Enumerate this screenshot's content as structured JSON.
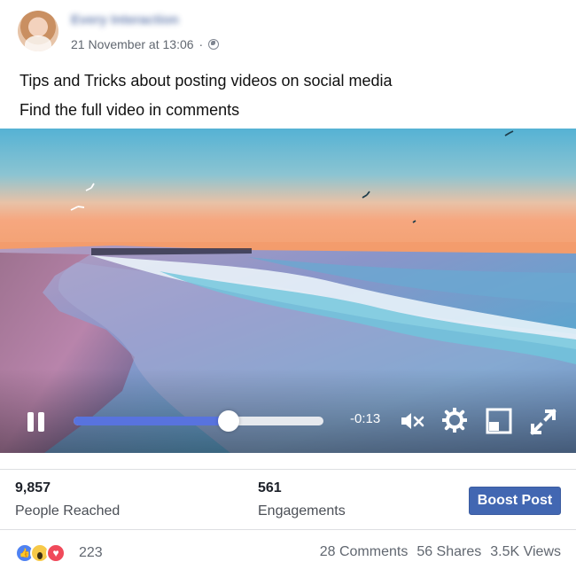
{
  "post": {
    "author": "Every Interaction",
    "timestamp": "21 November at 13:06",
    "separator": "·",
    "text_line_1": "Tips and Tricks about posting videos on social media",
    "text_line_2": "Find the full video in comments"
  },
  "video": {
    "time_remaining": "-0:13",
    "progress_fraction": 0.62
  },
  "insights": {
    "people_reached_value": "9,857",
    "people_reached_label": "People Reached",
    "engagements_value": "561",
    "engagements_label": "Engagements",
    "boost_label": "Boost Post"
  },
  "footer": {
    "reaction_count": "223",
    "comments": "28 Comments",
    "shares": "56 Shares",
    "views": "3.5K Views"
  },
  "icons": {
    "privacy": "globe-icon",
    "pause": "pause-icon",
    "mute": "mute-icon",
    "settings": "gear-icon",
    "picture_in_picture": "pip-icon",
    "fullscreen": "fullscreen-icon",
    "reactions": [
      "like-icon",
      "wow-icon",
      "love-icon"
    ]
  },
  "colors": {
    "brand": "#4267b2",
    "progress": "#5873de",
    "link": "#3b5998"
  }
}
